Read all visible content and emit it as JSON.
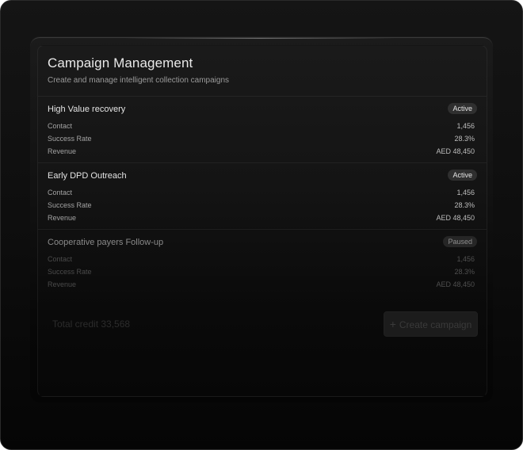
{
  "header": {
    "title": "Campaign Management",
    "subtitle": "Create and manage intelligent collection campaigns"
  },
  "campaigns": [
    {
      "name": "High Value recovery",
      "status": "Active",
      "metrics": [
        {
          "label": "Contact",
          "value": "1,456"
        },
        {
          "label": "Success Rate",
          "value": "28.3%"
        },
        {
          "label": "Revenue",
          "value": "AED 48,450"
        }
      ]
    },
    {
      "name": "Early DPD Outreach",
      "status": "Active",
      "metrics": [
        {
          "label": "Contact",
          "value": "1,456"
        },
        {
          "label": "Success Rate",
          "value": "28.3%"
        },
        {
          "label": "Revenue",
          "value": "AED 48,450"
        }
      ]
    },
    {
      "name": "Cooperative payers Follow-up",
      "status": "Paused",
      "metrics": [
        {
          "label": "Contact",
          "value": "1,456"
        },
        {
          "label": "Success Rate",
          "value": "28.3%"
        },
        {
          "label": "Revenue",
          "value": "AED 48,450"
        }
      ]
    }
  ],
  "footer": {
    "total_credit": "Total credit 33,568",
    "create_button_label": "Create campaign",
    "create_button_icon": "plus-icon"
  }
}
